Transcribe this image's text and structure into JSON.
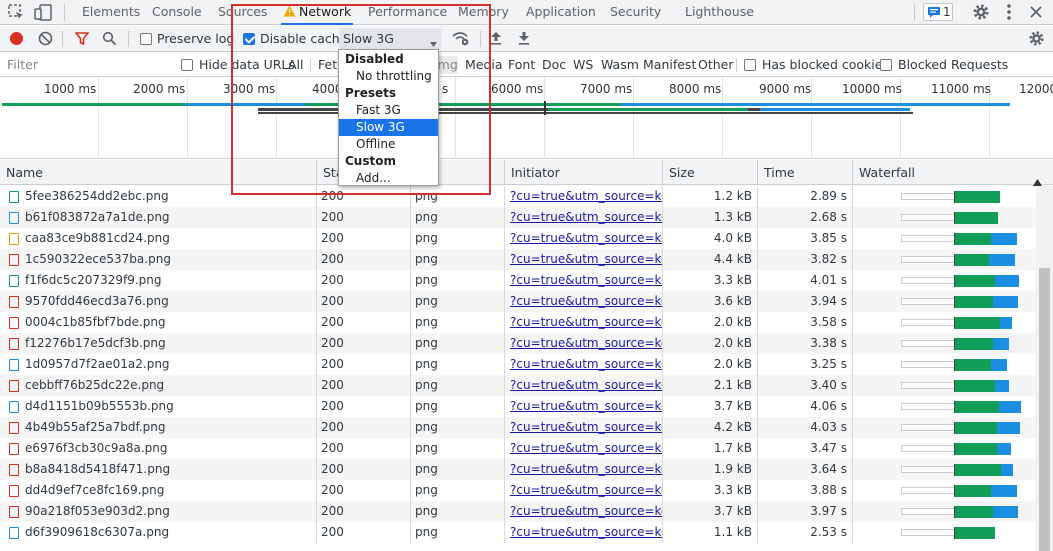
{
  "tabs": {
    "elements": "Elements",
    "console": "Console",
    "sources": "Sources",
    "network": "Network",
    "performance": "Performance",
    "memory": "Memory",
    "application": "Application",
    "security": "Security",
    "lighthouse": "Lighthouse",
    "issues_count": "1"
  },
  "toolbar": {
    "preserve_log": "Preserve log",
    "disable_cache": "Disable cache",
    "throttling": "Slow 3G"
  },
  "filter": {
    "placeholder": "Filter",
    "hide_data_urls": "Hide data URLs",
    "all": "All",
    "fetch": "Fetc",
    "img": "Img",
    "media": "Media",
    "font": "Font",
    "doc": "Doc",
    "ws": "WS",
    "wasm": "Wasm",
    "manifest": "Manifest",
    "other": "Other",
    "has_blocked_cookies": "Has blocked cookies",
    "blocked_requests": "Blocked Requests"
  },
  "overview": {
    "ticks": [
      "1000 ms",
      "2000 ms",
      "3000 ms",
      "4000",
      "s",
      "6000 ms",
      "7000 ms",
      "8000 ms",
      "9000 ms",
      "10000 ms",
      "11000 ms",
      "12000"
    ]
  },
  "columns": {
    "name": "Name",
    "status": "Sta",
    "type": "",
    "initiator": "Initiator",
    "size": "Size",
    "time": "Time",
    "waterfall": "Waterfall"
  },
  "rows": [
    {
      "name": "5fee386254dd2ebc.png",
      "status": "200",
      "type": "png",
      "initiator": "?cu=true&utm_source=ko...",
      "size": "1.2 kB",
      "time": "2.89 s",
      "g": 45,
      "b": 0,
      "ic": "#0f9d58"
    },
    {
      "name": "b61f083872a7a1de.png",
      "status": "200",
      "type": "png",
      "initiator": "?cu=true&utm_source=ko...",
      "size": "1.3 kB",
      "time": "2.68 s",
      "g": 43,
      "b": 0,
      "ic": "#1a8ee0"
    },
    {
      "name": "caa83ce9b881cd24.png",
      "status": "200",
      "type": "png",
      "initiator": "?cu=true&utm_source=ko...",
      "size": "4.0 kB",
      "time": "3.85 s",
      "g": 36,
      "b": 26,
      "ic": "#e6a100"
    },
    {
      "name": "1c590322ece537ba.png",
      "status": "200",
      "type": "png",
      "initiator": "?cu=true&utm_source=ko...",
      "size": "4.4 kB",
      "time": "3.82 s",
      "g": 34,
      "b": 26,
      "ic": "#d93025"
    },
    {
      "name": "f1f6dc5c207329f9.png",
      "status": "200",
      "type": "png",
      "initiator": "?cu=true&utm_source=ko...",
      "size": "3.3 kB",
      "time": "4.01 s",
      "g": 40,
      "b": 24,
      "ic": "#0f9d58"
    },
    {
      "name": "9570fdd46ecd3a76.png",
      "status": "200",
      "type": "png",
      "initiator": "?cu=true&utm_source=ko...",
      "size": "3.6 kB",
      "time": "3.94 s",
      "g": 38,
      "b": 25,
      "ic": "#d93025"
    },
    {
      "name": "0004c1b85fbf7bde.png",
      "status": "200",
      "type": "png",
      "initiator": "?cu=true&utm_source=ko...",
      "size": "2.0 kB",
      "time": "3.58 s",
      "g": 45,
      "b": 12,
      "ic": "#d93025"
    },
    {
      "name": "f12276b17e5dcf3b.png",
      "status": "200",
      "type": "png",
      "initiator": "?cu=true&utm_source=ko...",
      "size": "2.0 kB",
      "time": "3.38 s",
      "g": 38,
      "b": 16,
      "ic": "#d93025"
    },
    {
      "name": "1d0957d7f2ae01a2.png",
      "status": "200",
      "type": "png",
      "initiator": "?cu=true&utm_source=ko...",
      "size": "2.0 kB",
      "time": "3.25 s",
      "g": 36,
      "b": 16,
      "ic": "#1a8ee0"
    },
    {
      "name": "cebbff76b25dc22e.png",
      "status": "200",
      "type": "png",
      "initiator": "?cu=true&utm_source=ko...",
      "size": "2.1 kB",
      "time": "3.40 s",
      "g": 40,
      "b": 14,
      "ic": "#d93025"
    },
    {
      "name": "d4d1151b09b5553b.png",
      "status": "200",
      "type": "png",
      "initiator": "?cu=true&utm_source=ko...",
      "size": "3.7 kB",
      "time": "4.06 s",
      "g": 44,
      "b": 22,
      "ic": "#1a8ee0"
    },
    {
      "name": "4b49b55af25a7bdf.png",
      "status": "200",
      "type": "png",
      "initiator": "?cu=true&utm_source=ko...",
      "size": "4.2 kB",
      "time": "4.03 s",
      "g": 42,
      "b": 23,
      "ic": "#d93025"
    },
    {
      "name": "e6976f3cb30c9a8a.png",
      "status": "200",
      "type": "png",
      "initiator": "?cu=true&utm_source=ko...",
      "size": "1.7 kB",
      "time": "3.47 s",
      "g": 42,
      "b": 14,
      "ic": "#d93025"
    },
    {
      "name": "b8a8418d5418f471.png",
      "status": "200",
      "type": "png",
      "initiator": "?cu=true&utm_source=ko...",
      "size": "1.9 kB",
      "time": "3.64 s",
      "g": 46,
      "b": 12,
      "ic": "#d93025"
    },
    {
      "name": "dd4d9ef7ce8fc169.png",
      "status": "200",
      "type": "png",
      "initiator": "?cu=true&utm_source=ko...",
      "size": "3.3 kB",
      "time": "3.88 s",
      "g": 36,
      "b": 26,
      "ic": "#d93025"
    },
    {
      "name": "90a218f053e903d2.png",
      "status": "200",
      "type": "png",
      "initiator": "?cu=true&utm_source=ko...",
      "size": "3.7 kB",
      "time": "3.97 s",
      "g": 38,
      "b": 25,
      "ic": "#d93025"
    },
    {
      "name": "d6f3909618c6307a.png",
      "status": "200",
      "type": "png",
      "initiator": "?cu=true&utm_source=ko...",
      "size": "1.1 kB",
      "time": "2.53 s",
      "g": 40,
      "b": 0,
      "ic": "#1a8ee0"
    }
  ],
  "dropdown": {
    "disabled": "Disabled",
    "no_throttling": "No throttling",
    "presets": "Presets",
    "fast3g": "Fast 3G",
    "slow3g": "Slow 3G",
    "offline": "Offline",
    "custom": "Custom",
    "add": "Add..."
  }
}
